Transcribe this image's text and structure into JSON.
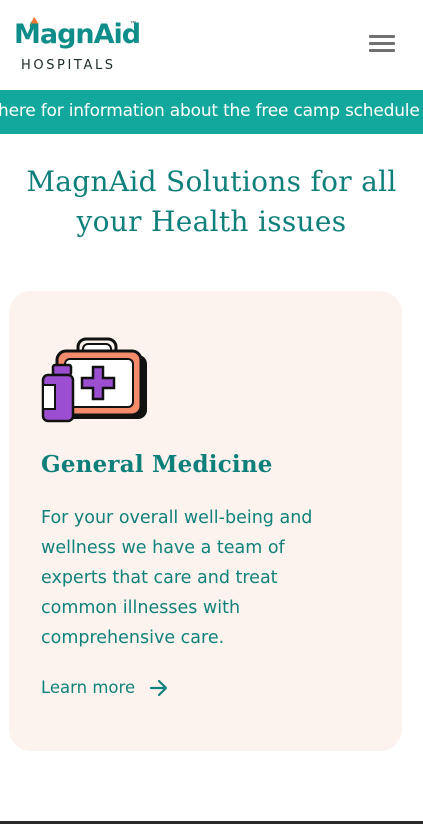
{
  "header": {
    "logo_main_part1": "Magn",
    "logo_main_part2": "Aid",
    "logo_tm": "™",
    "logo_sub": "HOSPITALS",
    "menu_icon": "hamburger-menu-icon"
  },
  "announcement": {
    "text": "here for information about the free camp schedule"
  },
  "hero": {
    "title": "MagnAid Solutions for all your Health issues"
  },
  "service_card": {
    "icon": "medical-kit-icon",
    "title": "General Medicine",
    "description": "For your overall well-being and wellness we have a team of experts that care and treat common illnesses with comprehensive care.",
    "link_label": "Learn more",
    "link_icon": "arrow-right-icon"
  },
  "colors": {
    "brand_teal": "#12a89d",
    "text_teal": "#0f7f7b",
    "card_bg": "#fcf3ee",
    "logo_orange": "#f0792f"
  }
}
